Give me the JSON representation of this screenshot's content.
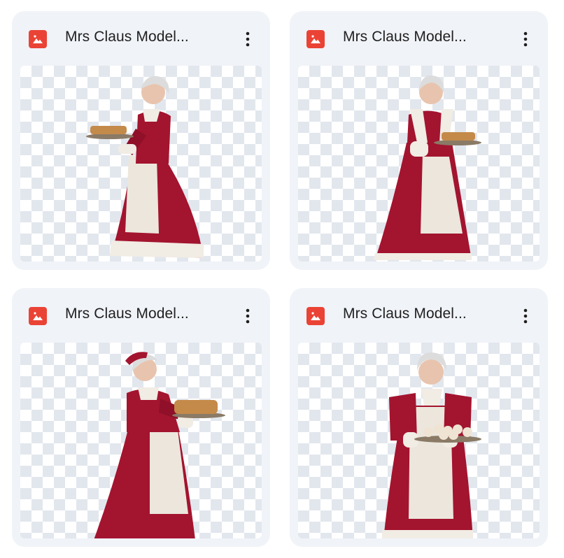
{
  "files": [
    {
      "name": "Mrs Claus Model...",
      "icon": "image-file-icon",
      "menu_icon": "more-vert-icon",
      "pose": "side-facing-left-holding-tray"
    },
    {
      "name": "Mrs Claus Model...",
      "icon": "image-file-icon",
      "menu_icon": "more-vert-icon",
      "pose": "front-holding-tray"
    },
    {
      "name": "Mrs Claus Model...",
      "icon": "image-file-icon",
      "menu_icon": "more-vert-icon",
      "pose": "side-facing-right-holding-tray"
    },
    {
      "name": "Mrs Claus Model...",
      "icon": "image-file-icon",
      "menu_icon": "more-vert-icon",
      "pose": "front-smiling-holding-cookies"
    }
  ],
  "colors": {
    "card_bg": "#f0f3f8",
    "icon_red": "#ea4335",
    "dress_red": "#a3142f",
    "fur_white": "#f1ece4",
    "apron": "#ece6dc",
    "skin": "#e8c4ae",
    "hair": "#dcdcdc",
    "tray": "#8a7a66",
    "cookie": "#c48a4a"
  }
}
